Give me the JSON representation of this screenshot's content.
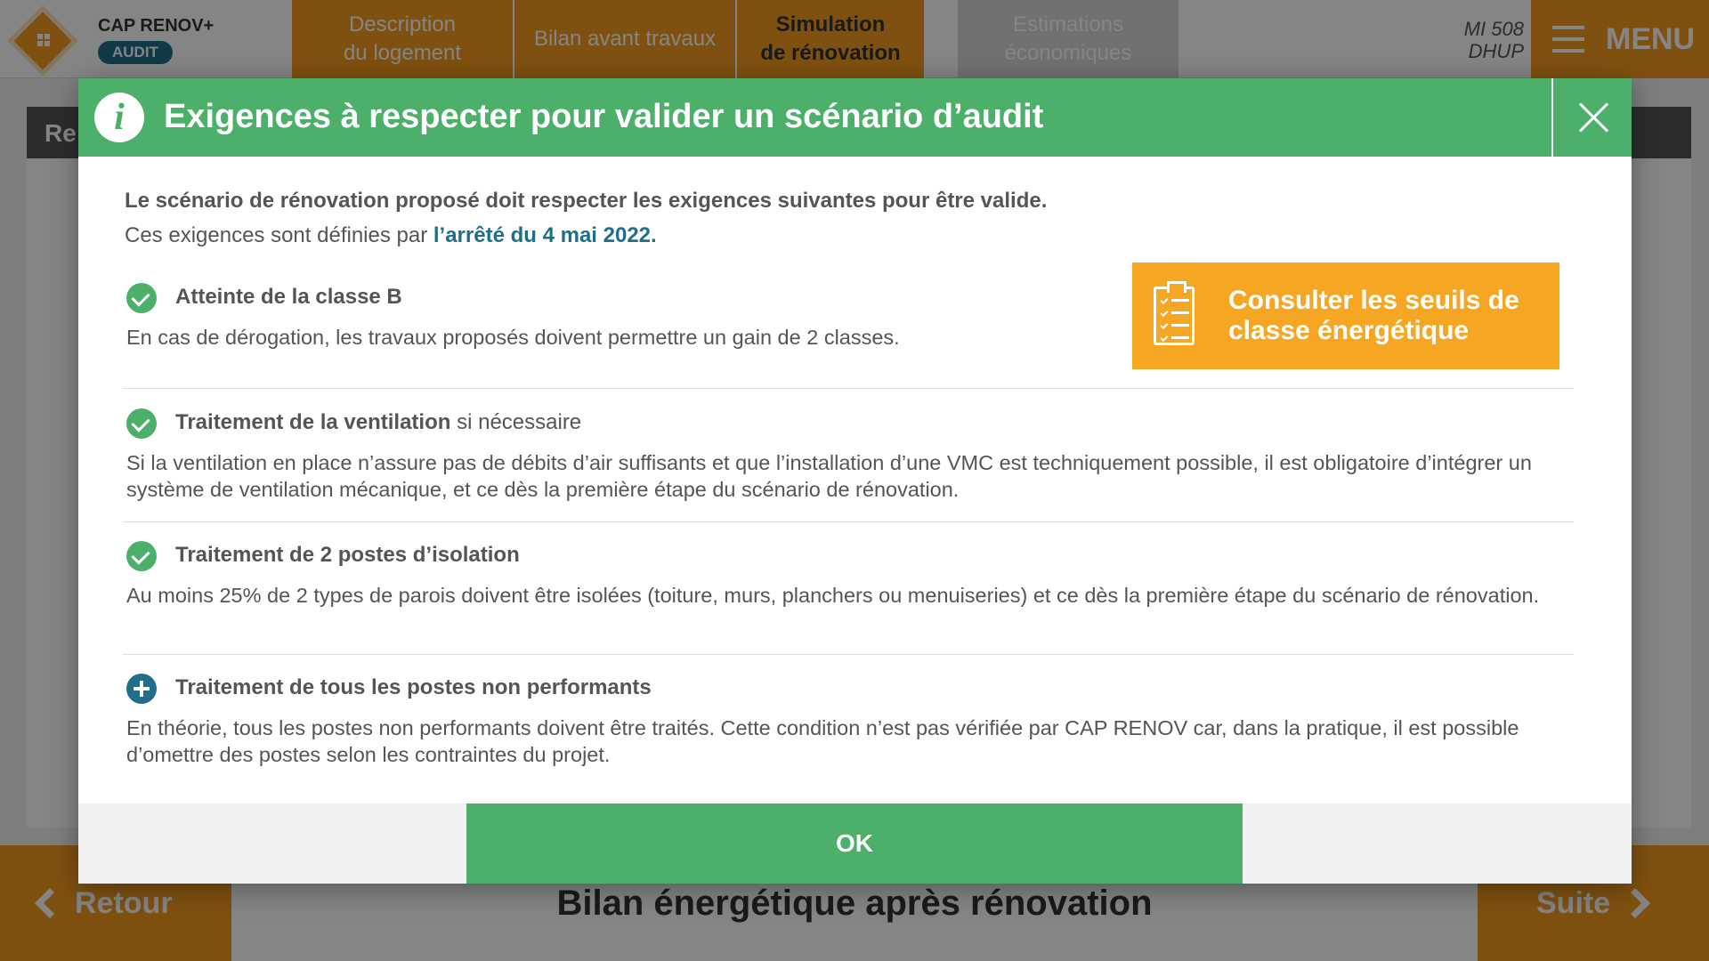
{
  "app": {
    "logo_title": "CAP RENOV+",
    "logo_badge": "AUDIT",
    "version_line1": "MI 508",
    "version_line2": "DHUP",
    "menu_label": "MENU"
  },
  "tabs": [
    {
      "line1": "Description",
      "line2": "du logement"
    },
    {
      "line1": "Bilan avant travaux",
      "line2": ""
    },
    {
      "line1": "Simulation",
      "line2": "de rénovation"
    },
    {
      "line1": "Estimations",
      "line2": "économiques"
    }
  ],
  "background": {
    "left_panel_header": "Re"
  },
  "bottom": {
    "back_label": "Retour",
    "title": "Bilan énergétique après rénovation",
    "next_label": "Suite"
  },
  "modal": {
    "title": "Exigences à respecter pour valider un scénario d’audit",
    "intro_bold": "Le scénario de rénovation proposé doit respecter les exigences suivantes pour être valide.",
    "intro_prefix": "Ces exigences sont définies par ",
    "intro_link": "l’arrêté du 4 mai 2022.",
    "seuils_button": "Consulter les seuils de classe énergétique",
    "requirements": [
      {
        "title": "Atteinte de la classe B",
        "suffix": "",
        "desc": "En cas de dérogation, les travaux proposés doivent permettre un gain de 2 classes.",
        "icon": "check-circle-icon"
      },
      {
        "title": "Traitement de la ventilation",
        "suffix": " si nécessaire",
        "desc": "Si la ventilation en place n’assure pas de débits d’air suffisants et que l’installation d’une VMC est techniquement possible, il est obligatoire d’intégrer un système de ventilation mécanique, et ce dès la première étape du scénario de rénovation.",
        "icon": "check-circle-icon"
      },
      {
        "title": "Traitement de 2 postes d’isolation",
        "suffix": "",
        "desc": "Au moins 25% de 2 types de parois doivent être isolées (toiture, murs, planchers ou menuiseries) et ce dès la première étape du scénario de rénovation.",
        "icon": "check-circle-icon"
      },
      {
        "title": "Traitement de tous les postes non performants",
        "suffix": "",
        "desc": "En théorie, tous les postes non performants doivent être traités. Cette condition n’est pas vérifiée par CAP RENOV car, dans la pratique, il est possible d’omettre des postes selon les contraintes du projet.",
        "icon": "plus-circle-icon"
      }
    ],
    "ok_label": "OK"
  },
  "colors": {
    "green": "#4caf6a",
    "orange": "#f39c1f",
    "blue": "#1f6f8b"
  }
}
